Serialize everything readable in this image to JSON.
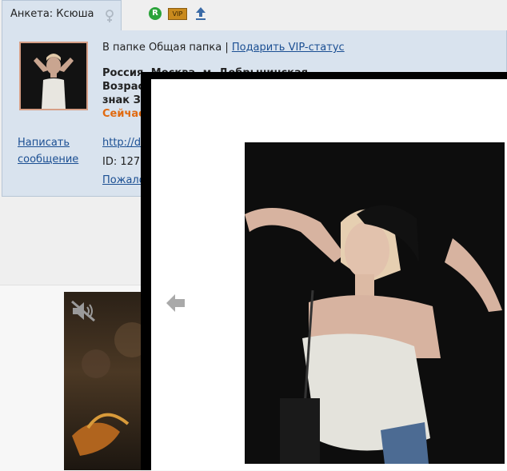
{
  "tab": {
    "label": "Анкета: Ксюша"
  },
  "badges": {
    "r_label": "R",
    "vip_label": "VIP"
  },
  "profile": {
    "folder_text": "В папке Общая папка | ",
    "vip_link": "Подарить VIP-статус",
    "line1": "Россия, Москва, м. Добрынинская",
    "line2": "Возраст",
    "line3": "знак За",
    "online": "Сейчас",
    "write_link": "Написать сообщение",
    "url": "http://d",
    "id_text": "ID: 127",
    "complain": "Пожало"
  },
  "colors": {
    "accent_link": "#1b4f93",
    "online_orange": "#e16a10",
    "panel_bg": "#d9e3ee"
  },
  "icons": [
    "female-icon",
    "upload-icon",
    "mute-icon",
    "prev-arrow-icon"
  ]
}
